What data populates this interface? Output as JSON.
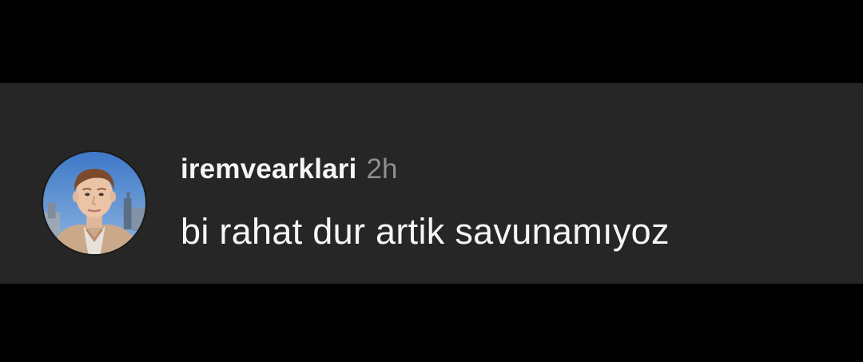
{
  "comment": {
    "username": "iremvearklari",
    "timestamp": "2h",
    "text": "bi rahat dur artik savunamıyoz",
    "avatar_icon": "profile-photo"
  },
  "colors": {
    "page_background": "#000000",
    "card_background": "#262626",
    "primary_text": "#f5f5f5",
    "secondary_text": "#8e8e8e"
  }
}
